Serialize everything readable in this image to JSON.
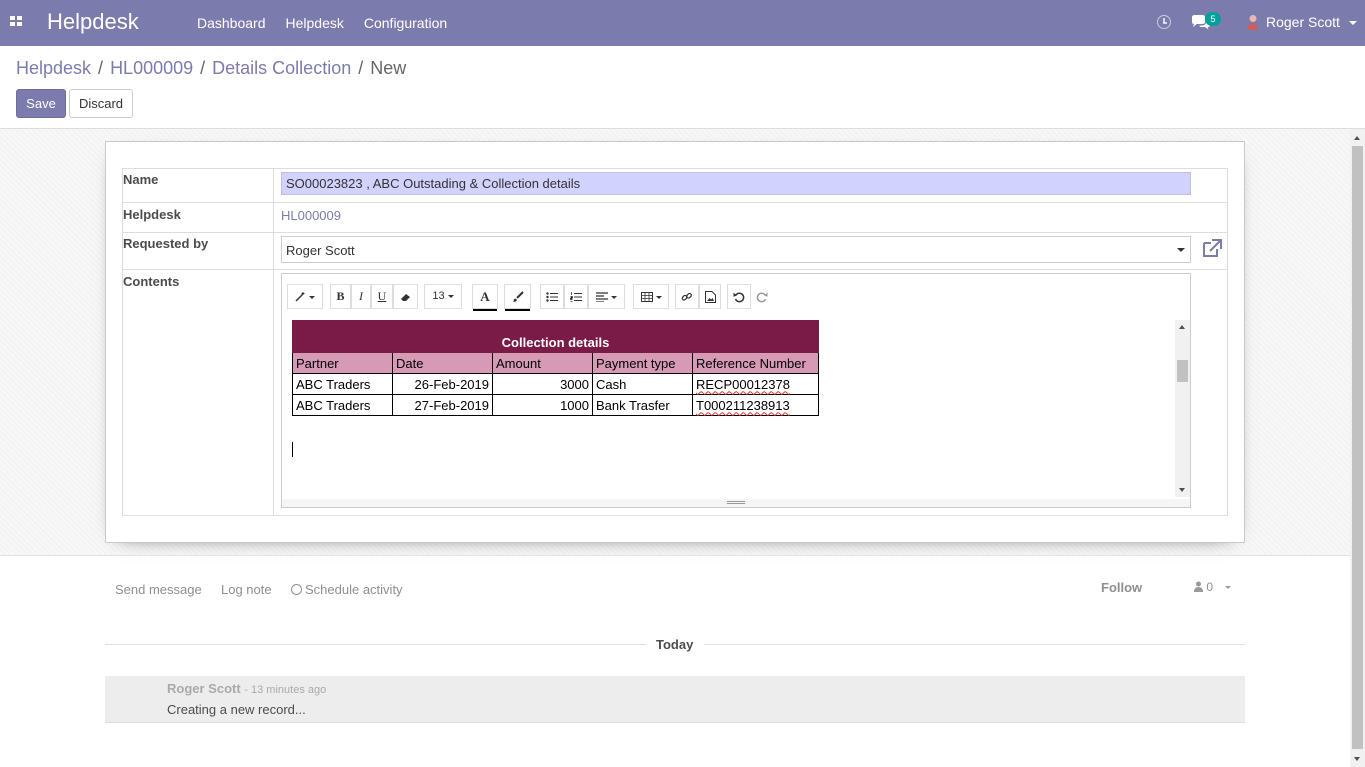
{
  "navbar": {
    "brand": "Helpdesk",
    "menu": [
      "Dashboard",
      "Helpdesk",
      "Configuration"
    ],
    "chat_badge": "5",
    "user": "Roger Scott"
  },
  "breadcrumb": [
    "Helpdesk",
    "HL000009",
    "Details Collection",
    "New"
  ],
  "buttons": {
    "save": "Save",
    "discard": "Discard"
  },
  "form": {
    "name_label": "Name",
    "name_value": "SO00023823 , ABC Outstading & Collection details",
    "helpdesk_label": "Helpdesk",
    "helpdesk_value": "HL000009",
    "requested_by_label": "Requested by",
    "requested_by_value": "Roger Scott",
    "contents_label": "Contents"
  },
  "editor": {
    "font_size": "13",
    "table": {
      "title": "Collection details",
      "headers": [
        "Partner",
        "Date",
        "Amount",
        "Payment type",
        "Reference Number"
      ],
      "rows": [
        [
          "ABC Traders",
          "26-Feb-2019",
          "3000",
          "Cash",
          "RECP00012378"
        ],
        [
          "ABC Traders",
          "27-Feb-2019",
          "1000",
          "Bank Trasfer",
          "T000211238913"
        ]
      ]
    },
    "colors": {
      "title_bg": "#7a1b47",
      "header_bg": "#d69ab7"
    }
  },
  "chatter": {
    "send_message": "Send message",
    "log_note": "Log note",
    "schedule_activity": "Schedule activity",
    "follow": "Follow",
    "followers_count": "0",
    "today": "Today",
    "message": {
      "author": "Roger Scott",
      "date": "- 13 minutes ago",
      "body": "Creating a new record..."
    }
  },
  "colors": {
    "brand": "#7c7bad",
    "name_field_bg": "#d2d2ff"
  }
}
